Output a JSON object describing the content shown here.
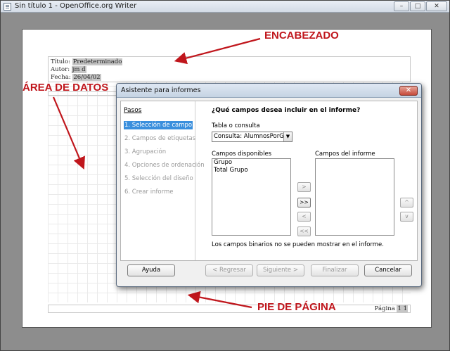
{
  "window": {
    "title": "Sin título 1 - OpenOffice.org Writer",
    "buttons": {
      "minimize": "–",
      "maximize": "□",
      "close": "✕"
    }
  },
  "document": {
    "header_lines": [
      {
        "label": "Título: ",
        "value": "Predeterminado"
      },
      {
        "label": "Autor: ",
        "value": "jm d"
      },
      {
        "label": "Fecha: ",
        "value": "26/04/02"
      }
    ],
    "footer": {
      "label": "Página ",
      "value": "1 1"
    }
  },
  "annotations": {
    "header": "ENCABEZADO",
    "data_area": "ÁREA DE DATOS",
    "footer": "PIE DE PÁGINA",
    "color": "#c0161c"
  },
  "dialog": {
    "title": "Asistente para informes",
    "close": "✕",
    "steps_heading": "Pasos",
    "steps": [
      {
        "label": "1. Selección de campo",
        "active": true
      },
      {
        "label": "2. Campos de etiquetas",
        "active": false
      },
      {
        "label": "3. Agrupación",
        "active": false
      },
      {
        "label": "4. Opciones de ordenación",
        "active": false
      },
      {
        "label": "5. Selección del diseño",
        "active": false
      },
      {
        "label": "6. Crear informe",
        "active": false
      }
    ],
    "question": "¿Qué campos desea incluir en el informe?",
    "table_label": "Tabla o consulta",
    "table_value": "Consulta: AlumnosPorGrupo",
    "available_label": "Campos disponibles",
    "report_label": "Campos del informe",
    "available_fields": [
      "Grupo",
      "Total Grupo"
    ],
    "report_fields": [],
    "move_buttons": {
      "add": ">",
      "add_all": ">>",
      "remove": "<",
      "remove_all": "<<",
      "up": "^",
      "down": "v"
    },
    "note": "Los campos binarios no se pueden mostrar en el informe.",
    "buttons": {
      "help": "Ayuda",
      "back": "< Regresar",
      "next": "Siguiente >",
      "finish": "Finalizar",
      "cancel": "Cancelar"
    }
  }
}
